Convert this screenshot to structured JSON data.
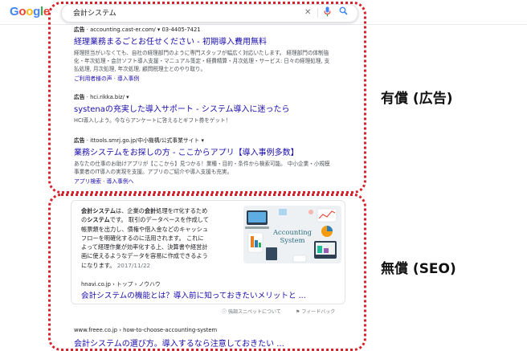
{
  "logo": {
    "text": "Google",
    "letters": [
      "G",
      "o",
      "o",
      "g",
      "l",
      "e"
    ],
    "colors": [
      "#4285f4",
      "#ea4335",
      "#fbbc05",
      "#4285f4",
      "#34a853",
      "#ea4335"
    ]
  },
  "search": {
    "query": "会計システム",
    "clear_icon": "close-icon",
    "voice_icon": "mic-icon",
    "search_icon": "search-icon"
  },
  "ads": [
    {
      "badge": "広告",
      "domain": "accounting.cast-er.com/",
      "phone": "03-4405-7421",
      "title": "経理業務まるごとお任せください - 初期導入費用無料",
      "description": "経理担当がいなくても、自社の経理部門のように専門スタッフが幅広く対応いたします。 経理部門の体制強化・年次処理・会計ソフト導入支援・マニュアル策定・経費精算・月次処理・サービス: 日々の経理処理, 支払処理, 月次処理, 年次処理, 顧問税理士とのやり取り。",
      "links": "ご利用者様の声 · 導入事例"
    },
    {
      "badge": "広告",
      "domain": "hci.rikka.biz/",
      "title": "systenaの充実した導入サポート - システム導入に迷ったら",
      "description": "HCI導入しよう。今ならアンケートに答えるとギフト券をゲット！"
    },
    {
      "badge": "広告",
      "domain": "ittools.smrj.go.jp/中小機構/公式事業サイト",
      "title": "業務システムをお探しの方 - ここからアプリ【導入事例多数】",
      "description": "あなたの仕事のお助けアプリが【ここから】見つかる！業種・目的・条件から検索可能。 中小企業・小規模事業者のIT導入の実現を支援。アプリのご紹介や導入支援も充実。",
      "links": "アプリ検索 · 導入事例へ"
    }
  ],
  "labels": {
    "paid": "有償 (広告)",
    "free": "無償 (SEO)"
  },
  "snippet": {
    "lines": [
      [
        "b:会計システム",
        "は、企業の",
        "b:会計",
        "処理をIT化するため"
      ],
      [
        "の",
        "b:システム",
        "です。 取引のデータベースを作成して"
      ],
      [
        "帳票類を出力し、債権や借入金などのキャッシュ"
      ],
      [
        "フローを明確化するのに活用されます。 これに"
      ],
      [
        "よって経理作業が効率化する上、決算書や経営計"
      ],
      [
        "画に使えるようなデータを容易に作成できるよう"
      ],
      [
        "になります。 ",
        "d:2017/11/22"
      ]
    ],
    "image_caption": "Accounting System",
    "source": "hnavi.co.jp › トップ › ノウハウ",
    "title": "会計システムの機能とは？導入前に知っておきたいメリットと ..."
  },
  "feedback": {
    "about": "強調スニペットについて",
    "feedback": "フィードバック"
  },
  "organic": {
    "url": "www.freee.co.jp › how-to-choose-accounting-system",
    "title": "会計システムの選び方。導入するなら注意しておきたい ..."
  },
  "colors": {
    "link": "#1a0dab",
    "frame": "#d6202a",
    "text": "#202124",
    "muted": "#70757a"
  }
}
